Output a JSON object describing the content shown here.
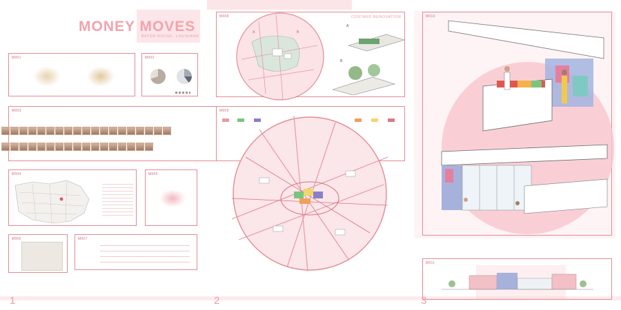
{
  "title": "MONEY MOVES",
  "subtitle": "BATON ROUGE, LOUISIANA",
  "pages": [
    "1",
    "2",
    "3"
  ],
  "panels": {
    "m01": "M001",
    "m02": "M002",
    "m03": "M003",
    "m04": "M004",
    "m05": "M005",
    "m06": "M006",
    "m07": "M007",
    "m08": "M008",
    "m09": "M009",
    "m10": "M010",
    "m11": "M011"
  },
  "renovation_label": "COSTANS RENOVATION",
  "option_a": "A",
  "option_b": "B",
  "map_a": "A",
  "map_b": "B",
  "legend": [
    "",
    "",
    "",
    "",
    "",
    "",
    "",
    ""
  ],
  "colors": {
    "accent": "#e38a94",
    "wash": "#fbdde1",
    "green": "#7bc47f",
    "purple": "#8b7fc9",
    "orange": "#f0a05a",
    "yellow": "#f2d66b"
  }
}
